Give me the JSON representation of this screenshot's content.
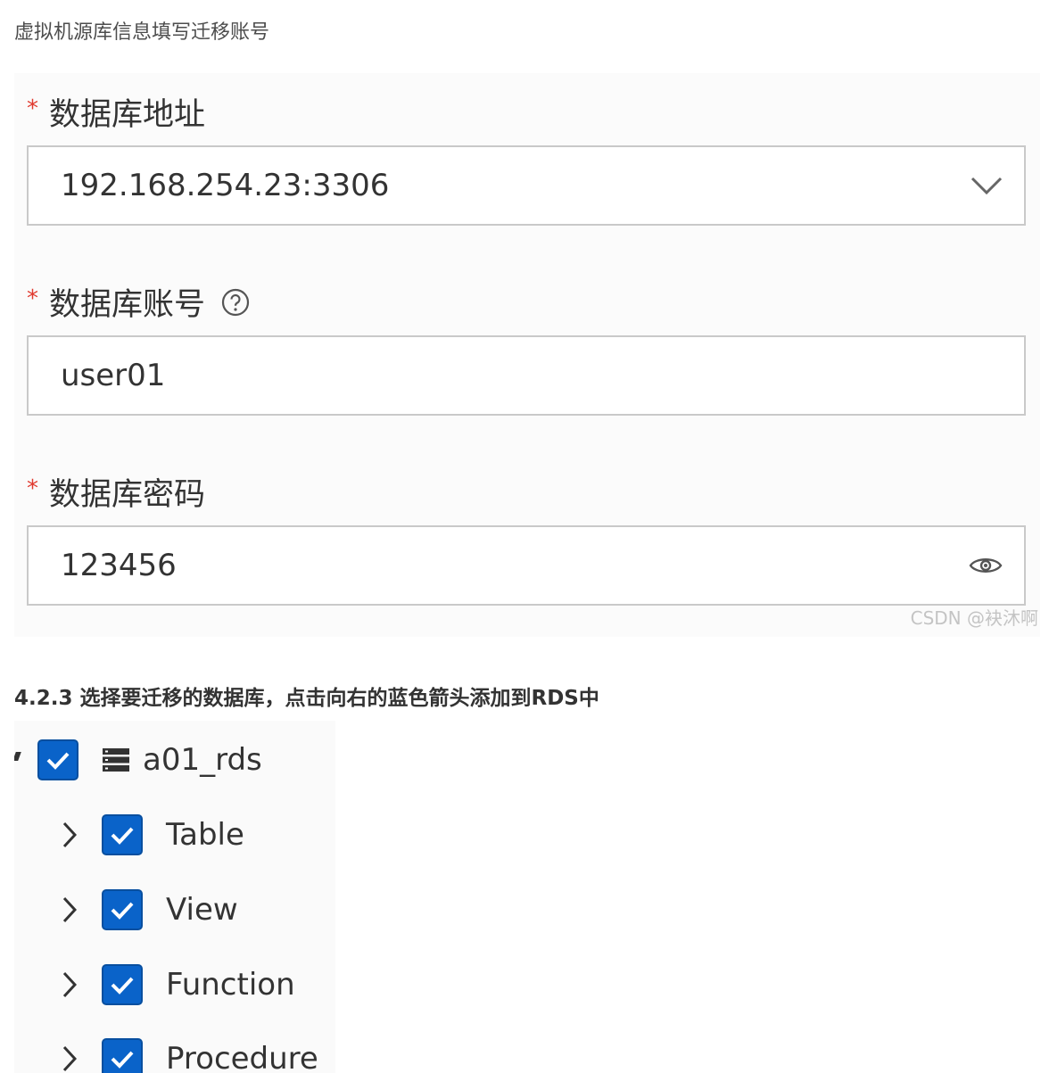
{
  "intro_text": "虚拟机源库信息填写迁移账号",
  "form": {
    "required_mark": "*",
    "address": {
      "label": "数据库地址",
      "value": "192.168.254.23:3306",
      "icon": "chevron-down-icon"
    },
    "account": {
      "label": "数据库账号",
      "help_icon": "question-circle-icon",
      "value": "user01"
    },
    "password": {
      "label": "数据库密码",
      "value": "123456",
      "icon": "eye-icon"
    },
    "watermark": "CSDN @袂沐啊"
  },
  "section_heading": "4.2.3 选择要迁移的数据库，点击向右的蓝色箭头添加到RDS中",
  "tree": {
    "root": {
      "label": "a01_rds",
      "checked": true,
      "icon": "database-icon"
    },
    "children": [
      {
        "label": "Table",
        "checked": true
      },
      {
        "label": "View",
        "checked": true
      },
      {
        "label": "Function",
        "checked": true
      },
      {
        "label": "Procedure",
        "checked": true
      }
    ]
  },
  "colors": {
    "checkbox": "#0a63c9",
    "required": "#e03a2f"
  }
}
